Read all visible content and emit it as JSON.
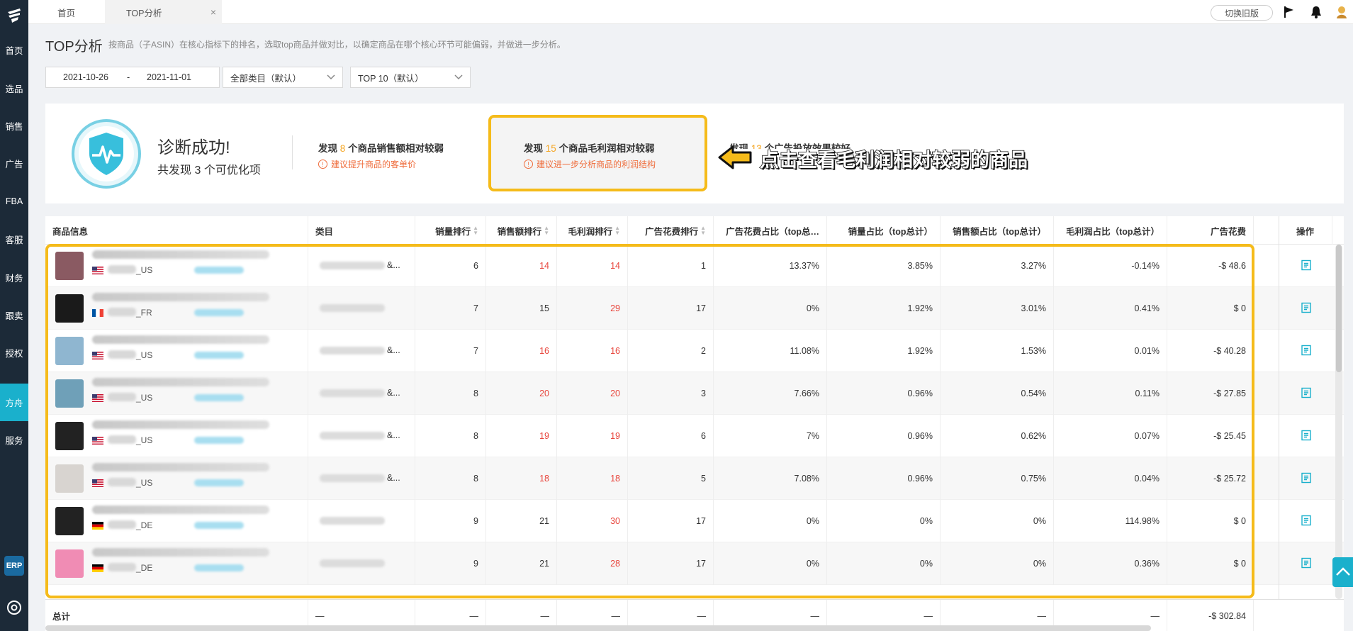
{
  "sidebar": {
    "items": [
      "首页",
      "选品",
      "销售",
      "广告",
      "FBA",
      "客服",
      "财务",
      "跟卖",
      "授权",
      "方舟",
      "服务"
    ],
    "active_index": 9,
    "erp_label": "ERP"
  },
  "topbar": {
    "tabs": [
      {
        "label": "首页"
      },
      {
        "label": "TOP分析",
        "close": "×"
      }
    ],
    "old_version": "切换旧版"
  },
  "page": {
    "title": "TOP分析",
    "subtitle": "按商品（子ASIN）在核心指标下的排名，选取top商品并做对比，以确定商品在哪个核心环节可能偏弱，并做进一步分析。"
  },
  "filters": {
    "date_start": "2021-10-26",
    "date_sep": "-",
    "date_end": "2021-11-01",
    "category": "全部类目（默认）",
    "top": "TOP 10（默认）"
  },
  "summary": {
    "title": "诊断成功!",
    "sub_prefix": "共发现",
    "sub_count": "3",
    "sub_suffix": "个可优化项",
    "issues": [
      {
        "prefix": "发现",
        "count": "8",
        "text": "个商品销售额相对较弱",
        "tip": "建议提升商品的客单价"
      },
      {
        "prefix": "发现",
        "count": "15",
        "text": "个商品毛利润相对较弱",
        "tip": "建议进一步分析商品的利润结构"
      },
      {
        "prefix": "发现",
        "count": "13",
        "text": "个广告投放效果较好",
        "tip": ""
      }
    ],
    "callout": "点击查看毛利润相对较弱的商品"
  },
  "table": {
    "headers": [
      "商品信息",
      "类目",
      "销量排行",
      "销售额排行",
      "毛利润排行",
      "广告花费排行",
      "广告花费占比（top总…",
      "销量占比（top总计）",
      "销售额占比（top总计）",
      "毛利润占比（top总计）",
      "广告花费",
      "操作"
    ],
    "rows": [
      {
        "market": "_US",
        "cat": "&...",
        "sales_rank": "6",
        "rev_rank": "14",
        "profit_rank": "14",
        "ad_rank": "1",
        "ad_pct": "13.37%",
        "qty_pct": "3.85%",
        "rev_pct": "3.27%",
        "profit_pct": "-0.14%",
        "ad_cost": "-$ 48.6",
        "rev_red": true,
        "profit_red": true
      },
      {
        "market": "_FR",
        "cat": "",
        "sales_rank": "7",
        "rev_rank": "15",
        "profit_rank": "29",
        "ad_rank": "17",
        "ad_pct": "0%",
        "qty_pct": "1.92%",
        "rev_pct": "3.01%",
        "profit_pct": "0.41%",
        "ad_cost": "$ 0",
        "rev_red": false,
        "profit_red": true
      },
      {
        "market": "_US",
        "cat": "&...",
        "sales_rank": "7",
        "rev_rank": "16",
        "profit_rank": "16",
        "ad_rank": "2",
        "ad_pct": "11.08%",
        "qty_pct": "1.92%",
        "rev_pct": "1.53%",
        "profit_pct": "0.01%",
        "ad_cost": "-$ 40.28",
        "rev_red": true,
        "profit_red": true
      },
      {
        "market": "_US",
        "cat": "&...",
        "sales_rank": "8",
        "rev_rank": "20",
        "profit_rank": "20",
        "ad_rank": "3",
        "ad_pct": "7.66%",
        "qty_pct": "0.96%",
        "rev_pct": "0.54%",
        "profit_pct": "0.11%",
        "ad_cost": "-$ 27.85",
        "rev_red": true,
        "profit_red": true
      },
      {
        "market": "_US",
        "cat": "&...",
        "sales_rank": "8",
        "rev_rank": "19",
        "profit_rank": "19",
        "ad_rank": "6",
        "ad_pct": "7%",
        "qty_pct": "0.96%",
        "rev_pct": "0.62%",
        "profit_pct": "0.07%",
        "ad_cost": "-$ 25.45",
        "rev_red": true,
        "profit_red": true
      },
      {
        "market": "_US",
        "cat": "&...",
        "sales_rank": "8",
        "rev_rank": "18",
        "profit_rank": "18",
        "ad_rank": "5",
        "ad_pct": "7.08%",
        "qty_pct": "0.96%",
        "rev_pct": "0.75%",
        "profit_pct": "0.04%",
        "ad_cost": "-$ 25.72",
        "rev_red": true,
        "profit_red": true
      },
      {
        "market": "_DE",
        "cat": "",
        "sales_rank": "9",
        "rev_rank": "21",
        "profit_rank": "30",
        "ad_rank": "17",
        "ad_pct": "0%",
        "qty_pct": "0%",
        "rev_pct": "0%",
        "profit_pct": "114.98%",
        "ad_cost": "$ 0",
        "rev_red": false,
        "profit_red": true
      },
      {
        "market": "_DE",
        "cat": "",
        "sales_rank": "9",
        "rev_rank": "21",
        "profit_rank": "28",
        "ad_rank": "17",
        "ad_pct": "0%",
        "qty_pct": "0%",
        "rev_pct": "0%",
        "profit_pct": "0.36%",
        "ad_cost": "$ 0",
        "rev_red": false,
        "profit_red": true
      }
    ],
    "total": {
      "label": "总计",
      "dash": "—",
      "ad_cost": "-$ 302.84"
    }
  },
  "colors": {
    "accent": "#1ab0cc",
    "highlight": "#f5bb1a",
    "warn": "#ef6c3b",
    "rank_red": "#e8453c",
    "number_orange": "#f5a623"
  }
}
